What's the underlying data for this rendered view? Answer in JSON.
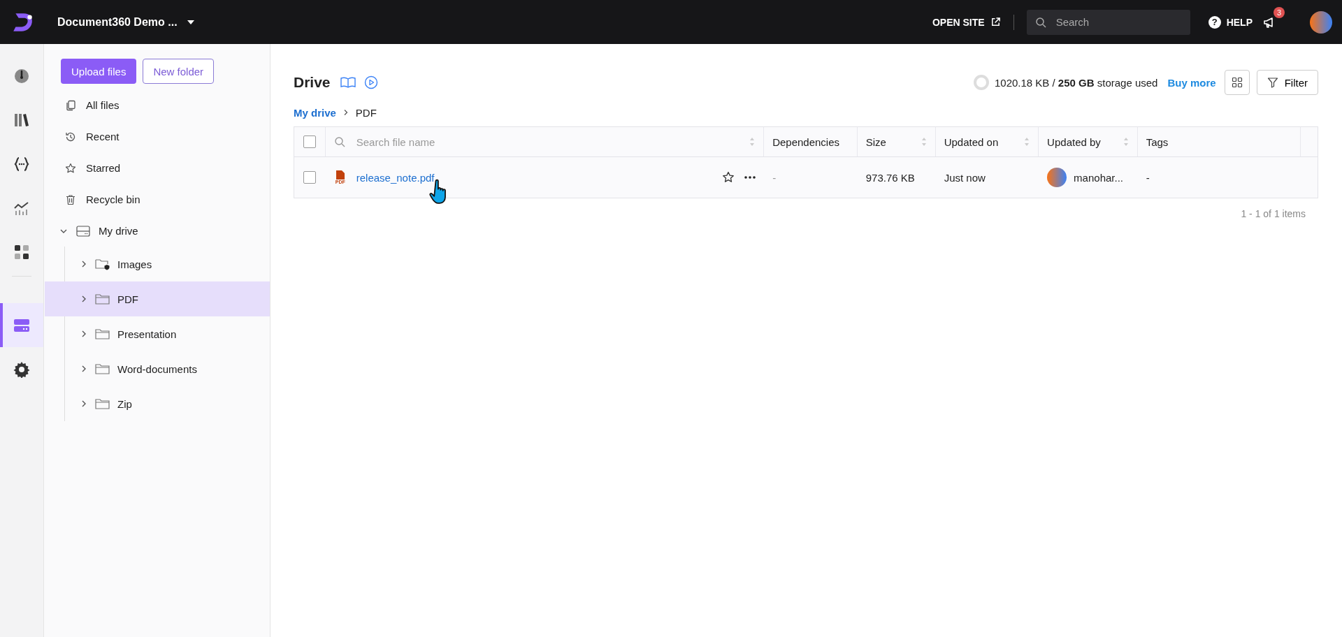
{
  "top_bar": {
    "project_name": "Document360 Demo ...",
    "open_site": "OPEN SITE",
    "search": {
      "placeholder": "Search"
    },
    "help_icon": "?",
    "help": "HELP",
    "notification_count": "3"
  },
  "rail_top": [
    {
      "kind": "dashboard",
      "selected": false
    },
    {
      "kind": "library",
      "selected": false
    },
    {
      "kind": "api",
      "selected": false
    },
    {
      "kind": "analytics",
      "selected": false
    },
    {
      "kind": "apps",
      "selected": false
    }
  ],
  "rail_bottom": [
    {
      "kind": "drive",
      "selected": true
    },
    {
      "kind": "settings",
      "selected": false
    }
  ],
  "sidebar": {
    "upload_button": "Upload files",
    "new_folder_button": "New folder",
    "items": [
      {
        "kind": "files",
        "label": "All files"
      },
      {
        "kind": "recent",
        "label": "Recent"
      },
      {
        "kind": "star",
        "label": "Starred"
      },
      {
        "kind": "bin",
        "label": "Recycle bin"
      }
    ],
    "tree": {
      "label": "My drive",
      "expanded": true,
      "children": [
        {
          "label": "Images",
          "kind": "shared",
          "selected": false,
          "expanded": false
        },
        {
          "label": "PDF",
          "kind": "folder",
          "selected": true,
          "expanded": false
        },
        {
          "label": "Presentation",
          "kind": "folder",
          "selected": false,
          "expanded": false
        },
        {
          "label": "Word-documents",
          "kind": "folder",
          "selected": false,
          "expanded": false
        },
        {
          "label": "Zip",
          "kind": "folder",
          "selected": false,
          "expanded": false
        }
      ]
    }
  },
  "main": {
    "title": "Drive",
    "storage": "1020.18 KB / **250 GB** storage used",
    "buy_more": "Buy more",
    "filter": "Filter",
    "breadcrumb": [
      {
        "label": "My drive",
        "link": true
      },
      {
        "label": "PDF",
        "link": false
      }
    ],
    "table": {
      "select_all_checked": false,
      "search": {
        "placeholder": "Search file name"
      },
      "columns": [
        {
          "label": "Dependencies",
          "sortable": false
        },
        {
          "label": "Size",
          "sortable": true
        },
        {
          "label": "Updated on",
          "sortable": true
        },
        {
          "label": "Updated by",
          "sortable": true
        },
        {
          "label": "Tags",
          "sortable": false
        }
      ],
      "rows": [
        {
          "checked": false,
          "name": "release_note.pdf",
          "file_type": "PDF",
          "starred": false,
          "dependencies": "-",
          "size": "973.76 KB",
          "updated_on": "Just now",
          "updated_by": "manohar...",
          "tags": "-"
        }
      ]
    },
    "pagination": "1 - 1 of 1 items"
  }
}
